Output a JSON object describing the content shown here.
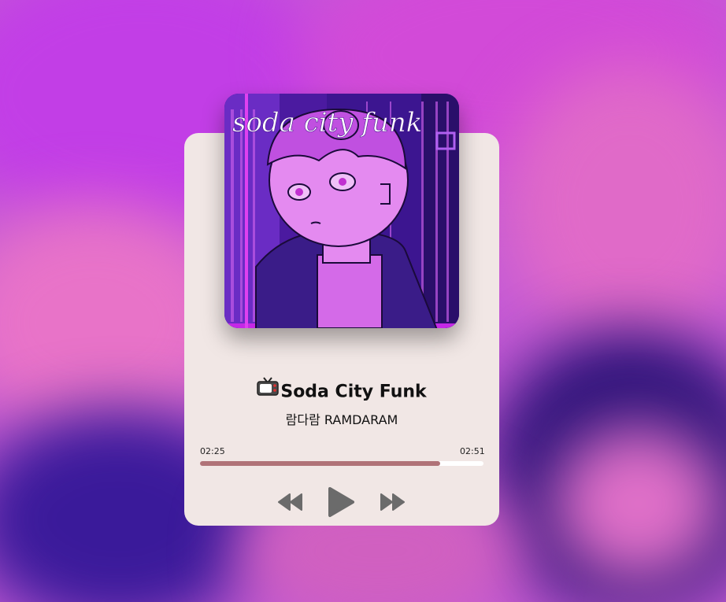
{
  "cover": {
    "text": "soda city funk",
    "alt_text": "Soda City Funk album art"
  },
  "track": {
    "title": "Soda City Funk",
    "title_icon": "tv-icon",
    "artist": "람다람 RAMDARAM"
  },
  "progress": {
    "current_time": "02:25",
    "total_time": "02:51",
    "fraction": 0.848
  },
  "controls": {
    "rewind_icon": "rewind-icon",
    "play_icon": "play-icon",
    "forward_icon": "fast-forward-icon"
  },
  "colors": {
    "card_bg": "#f1e7e5",
    "progress_fill": "#b07378",
    "progress_track": "#ffffff",
    "control_icon": "#6b6b6b"
  }
}
